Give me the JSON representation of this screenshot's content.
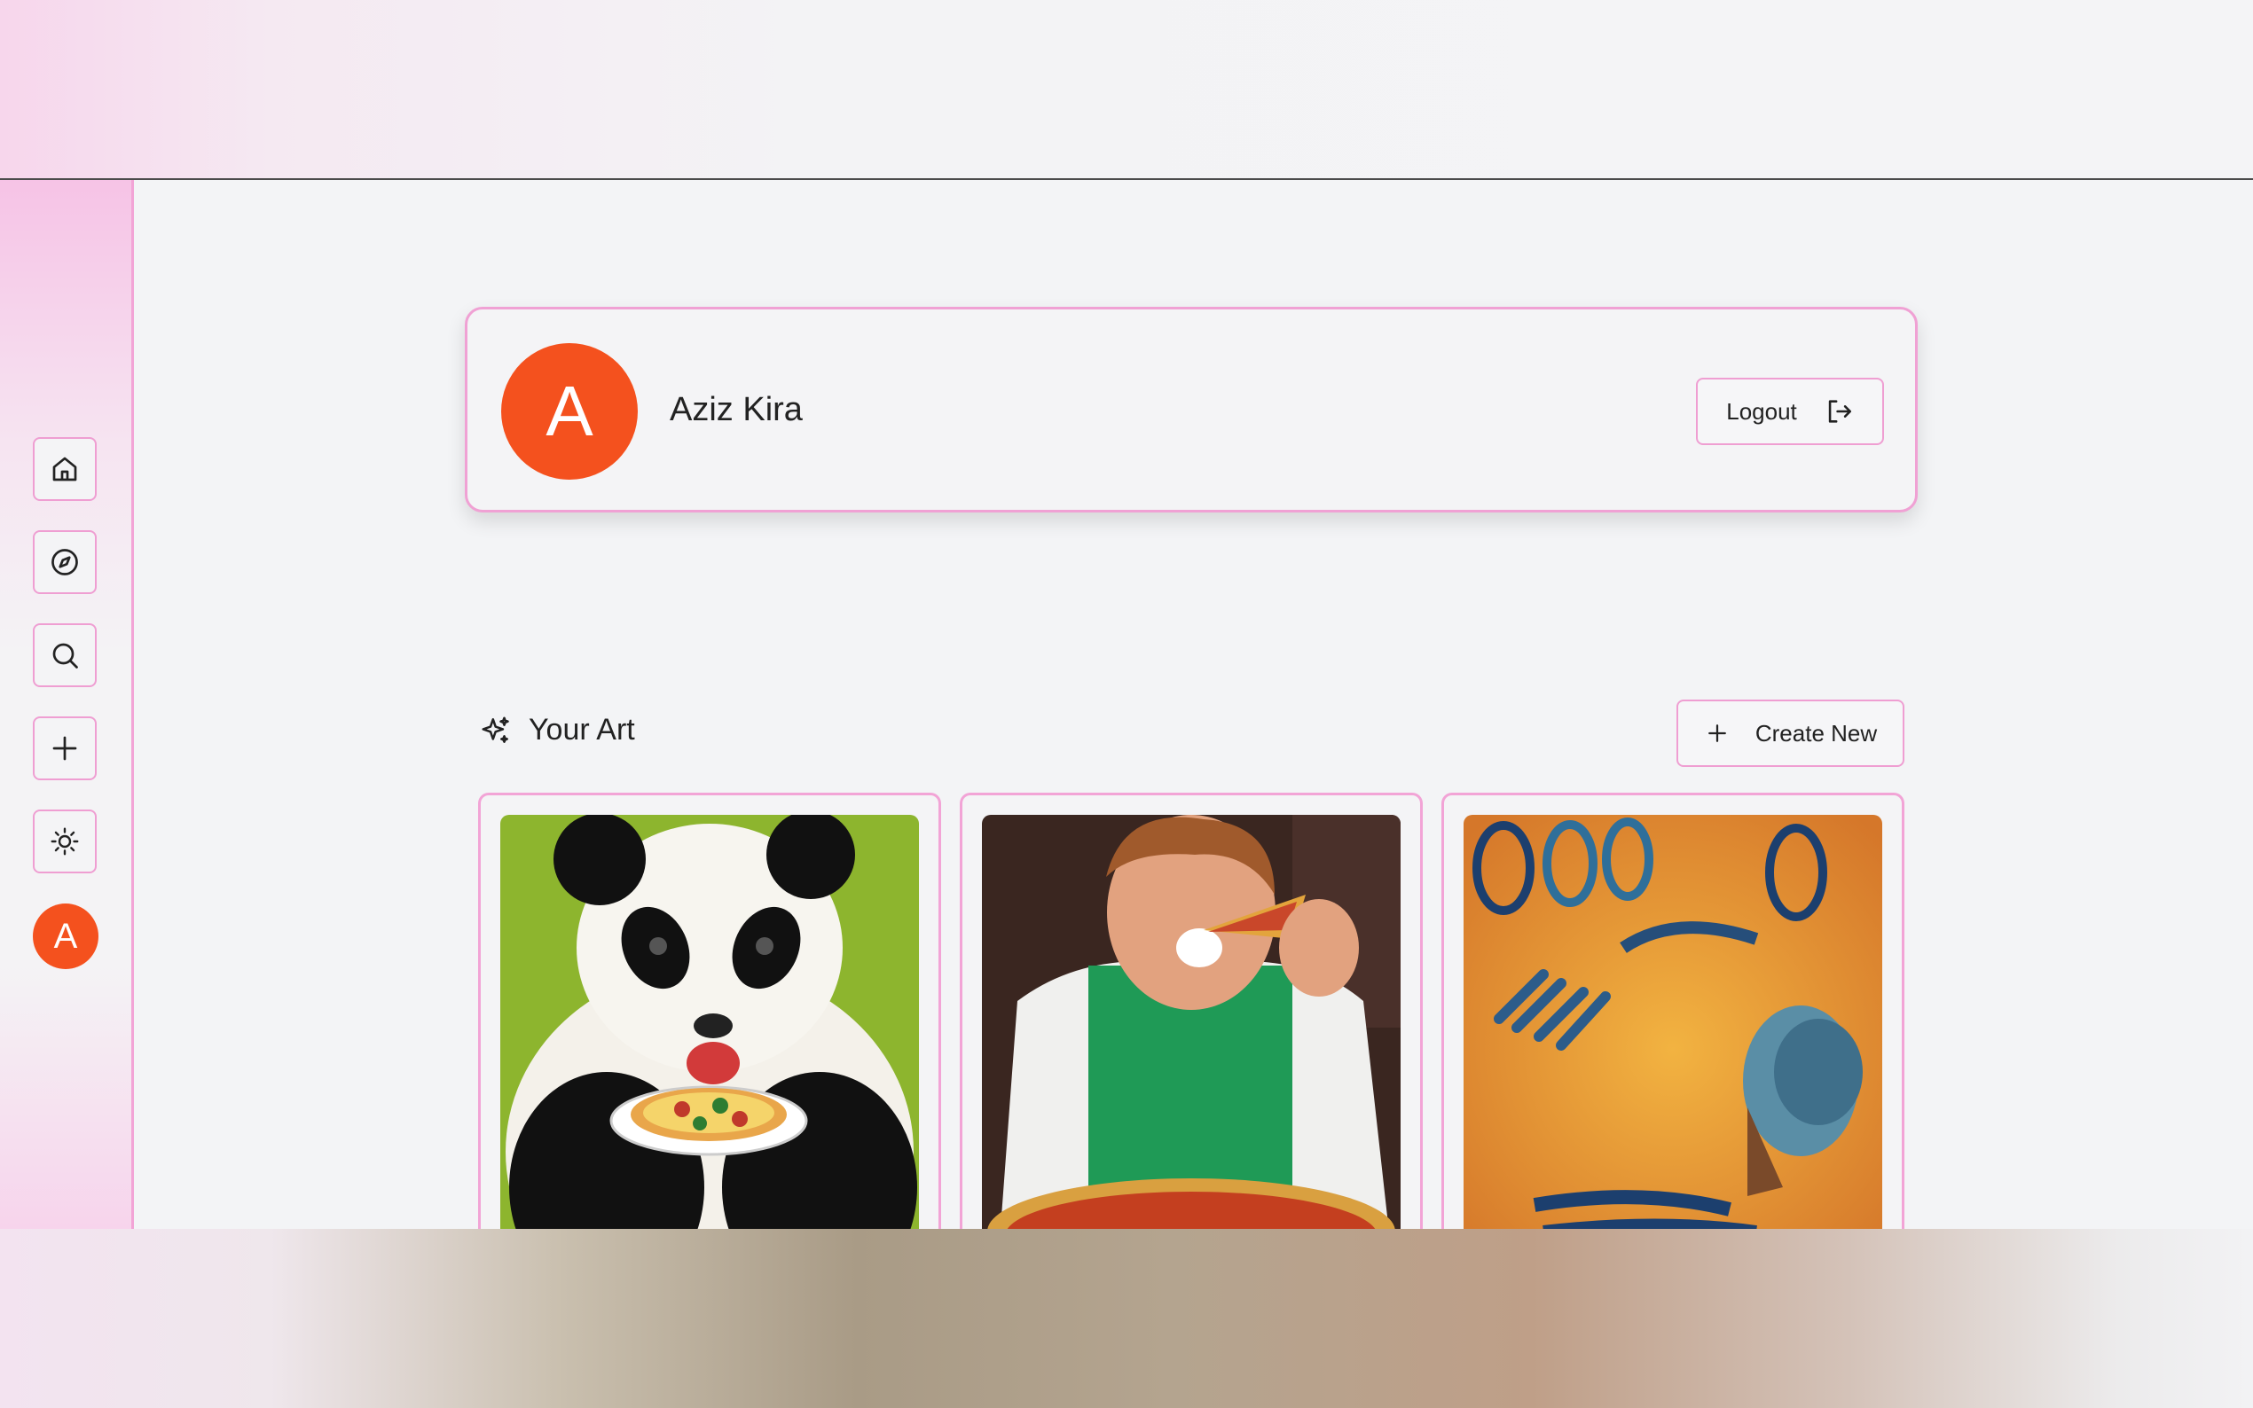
{
  "user": {
    "initial": "A",
    "name": "Aziz Kira"
  },
  "profile_card": {
    "logout_label": "Logout"
  },
  "sidebar": {
    "items": [
      {
        "icon": "home-icon"
      },
      {
        "icon": "compass-icon"
      },
      {
        "icon": "search-icon"
      },
      {
        "icon": "plus-icon"
      },
      {
        "icon": "sun-icon"
      }
    ],
    "avatar_initial": "A"
  },
  "gallery": {
    "title": "Your Art",
    "create_label": "Create New",
    "items": [
      {
        "subject": "panda eating pizza"
      },
      {
        "subject": "man eating pizza"
      },
      {
        "subject": "abstract portrait with lettering"
      }
    ]
  },
  "colors": {
    "accent_border": "#ef9ed2",
    "avatar": "#f4511e",
    "background": "#f3f4f6"
  }
}
